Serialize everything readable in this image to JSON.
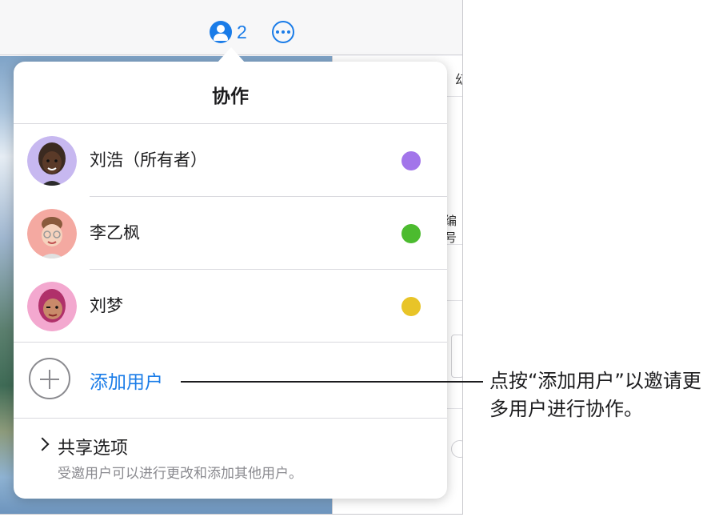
{
  "toolbar": {
    "collaborator_count": "2",
    "icons": [
      "collaborate-icon",
      "more-icon"
    ]
  },
  "background_app": {
    "side_fragment_1": "幻",
    "side_fragment_2": "编号"
  },
  "popover": {
    "title": "协作",
    "participants": [
      {
        "name": "刘浩（所有者）",
        "color": "#a275ea",
        "avatar_bg": "#c7b8f0"
      },
      {
        "name": "李乙枫",
        "color": "#4cbb2f",
        "avatar_bg": "#f4a9a1"
      },
      {
        "name": "刘梦",
        "color": "#e8c428",
        "avatar_bg": "#f3a8cf"
      }
    ],
    "add_user_label": "添加用户",
    "share_options_title": "共享选项",
    "share_options_subtitle": "受邀用户可以进行更改和添加其他用户。"
  },
  "callout": {
    "text": "点按“添加用户”以邀请更多用户进行协作。"
  },
  "colors": {
    "accent": "#1a7ce8"
  }
}
